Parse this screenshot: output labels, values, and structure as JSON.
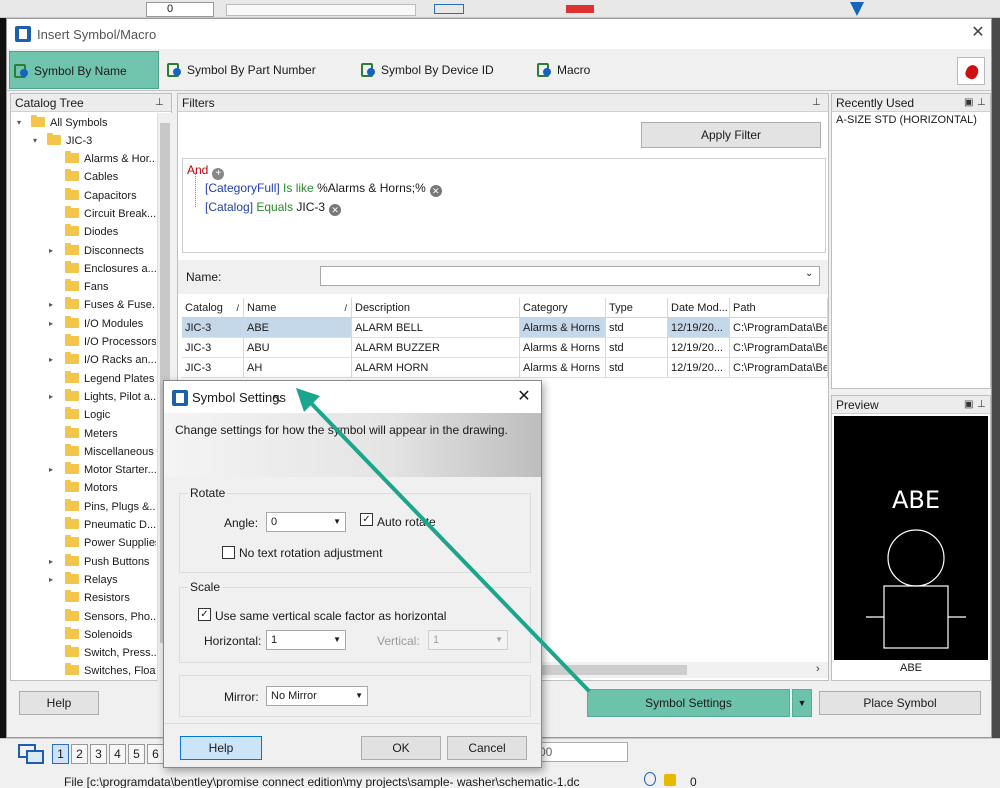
{
  "background": {
    "toolbar_combo_value": "0"
  },
  "window": {
    "title": "Insert Symbol/Macro"
  },
  "tabs": [
    {
      "label": "Symbol By Name"
    },
    {
      "label": "Symbol By Part Number"
    },
    {
      "label": "Symbol By Device ID"
    },
    {
      "label": "Macro"
    }
  ],
  "catalog": {
    "header": "Catalog Tree",
    "root": "All Symbols",
    "library": "JIC-3",
    "items": [
      {
        "label": "Alarms & Hor...",
        "expandable": false
      },
      {
        "label": "Cables",
        "expandable": false
      },
      {
        "label": "Capacitors",
        "expandable": false
      },
      {
        "label": "Circuit Break...",
        "expandable": false
      },
      {
        "label": "Diodes",
        "expandable": false
      },
      {
        "label": "Disconnects",
        "expandable": true
      },
      {
        "label": "Enclosures a...",
        "expandable": false
      },
      {
        "label": "Fans",
        "expandable": false
      },
      {
        "label": "Fuses & Fuse...",
        "expandable": true
      },
      {
        "label": "I/O Modules",
        "expandable": true
      },
      {
        "label": "I/O Processors",
        "expandable": false
      },
      {
        "label": "I/O Racks an...",
        "expandable": true
      },
      {
        "label": "Legend Plates",
        "expandable": false
      },
      {
        "label": "Lights, Pilot a...",
        "expandable": true
      },
      {
        "label": "Logic",
        "expandable": false
      },
      {
        "label": "Meters",
        "expandable": false
      },
      {
        "label": "Miscellaneous",
        "expandable": false
      },
      {
        "label": "Motor Starter...",
        "expandable": true
      },
      {
        "label": "Motors",
        "expandable": false
      },
      {
        "label": "Pins, Plugs &...",
        "expandable": false
      },
      {
        "label": "Pneumatic D...",
        "expandable": false
      },
      {
        "label": "Power Supplies",
        "expandable": false
      },
      {
        "label": "Push Buttons",
        "expandable": true
      },
      {
        "label": "Relays",
        "expandable": true
      },
      {
        "label": "Resistors",
        "expandable": false
      },
      {
        "label": "Sensors, Pho...",
        "expandable": false
      },
      {
        "label": "Solenoids",
        "expandable": false
      },
      {
        "label": "Switch, Press...",
        "expandable": false
      },
      {
        "label": "Switches, Float",
        "expandable": false
      }
    ]
  },
  "filters": {
    "header": "Filters",
    "apply_label": "Apply Filter",
    "root_op": "And",
    "conditions": [
      {
        "field": "[CategoryFull]",
        "op": "Is like",
        "value": "%Alarms & Horns;%"
      },
      {
        "field": "[Catalog]",
        "op": "Equals",
        "value": "JIC-3"
      }
    ],
    "name_label": "Name:",
    "name_value": ""
  },
  "grid": {
    "columns": [
      "Catalog",
      "Name",
      "Description",
      "Category",
      "Type",
      "Date Mod...",
      "Path"
    ],
    "rows": [
      [
        "JIC-3",
        "ABE",
        "ALARM BELL",
        "Alarms & Horns",
        "std",
        "12/19/20...",
        "C:\\ProgramData\\Be"
      ],
      [
        "JIC-3",
        "ABU",
        "ALARM BUZZER",
        "Alarms & Horns",
        "std",
        "12/19/20...",
        "C:\\ProgramData\\Be"
      ],
      [
        "JIC-3",
        "AH",
        "ALARM HORN",
        "Alarms & Horns",
        "std",
        "12/19/20...",
        "C:\\ProgramData\\Be"
      ]
    ]
  },
  "recent": {
    "header": "Recently Used",
    "items": [
      "A-SIZE STD (HORIZONTAL)"
    ]
  },
  "preview": {
    "header": "Preview",
    "symbol_text": "ABE",
    "caption": "ABE"
  },
  "footer": {
    "help_label": "Help",
    "symbol_settings_label": "Symbol Settings",
    "place_label": "Place Symbol"
  },
  "symbol_settings": {
    "title": "Symbol Settings",
    "description": "Change settings for how the symbol will appear in the drawing.",
    "rotate_group": "Rotate",
    "angle_label": "Angle:",
    "angle_value": "0",
    "auto_rotate_label": "Auto rotate",
    "auto_rotate_checked": true,
    "no_text_rotation_label": "No text rotation adjustment",
    "no_text_rotation_checked": false,
    "scale_group": "Scale",
    "same_scale_label": "Use same vertical scale factor as horizontal",
    "same_scale_checked": true,
    "horizontal_label": "Horizontal:",
    "horizontal_value": "1",
    "vertical_label": "Vertical:",
    "vertical_value": "1",
    "mirror_label": "Mirror:",
    "mirror_value": "No Mirror",
    "help_label": "Help",
    "ok_label": "OK",
    "cancel_label": "Cancel"
  },
  "status": {
    "pages": [
      "1",
      "2",
      "3",
      "4",
      "5",
      "6"
    ],
    "active_page": "1",
    "zoom_value": "00",
    "file_path": "File [c:\\programdata\\bentley\\promise connect edition\\my projects\\sample- washer\\schematic-1.dc",
    "right_value": "0"
  },
  "colors": {
    "highlight": "#70c4ae",
    "annotation_arrow": "#1aa58c",
    "selection_row": "#c5d8ea"
  }
}
